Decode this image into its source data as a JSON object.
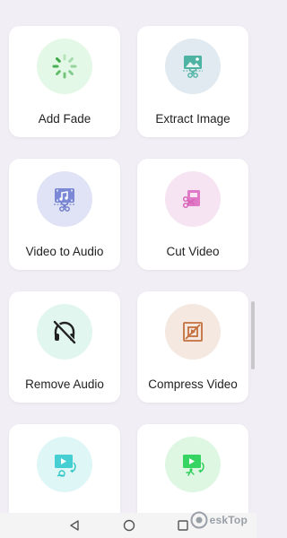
{
  "tools": [
    {
      "label": "Add Fade",
      "icon": "fade-spinner-icon",
      "bg": "#e3f8e6",
      "accent": "#3aa845"
    },
    {
      "label": "Extract Image",
      "icon": "extract-image-icon",
      "bg": "#e0eaf0",
      "accent": "#3a9d8c"
    },
    {
      "label": "Video to Audio",
      "icon": "video-to-audio-icon",
      "bg": "#e0e3f6",
      "accent": "#6a78c9"
    },
    {
      "label": "Cut Video",
      "icon": "cut-video-icon",
      "bg": "#f6e4f2",
      "accent": "#d864b8"
    },
    {
      "label": "Remove Audio",
      "icon": "remove-audio-icon",
      "bg": "#e2f6f0",
      "accent": "#222222"
    },
    {
      "label": "Compress Video",
      "icon": "compress-video-icon",
      "bg": "#f4e8e0",
      "accent": "#c4703e"
    },
    {
      "label": "",
      "icon": "slow-motion-icon",
      "bg": "#dff6f6",
      "accent": "#36c7c9"
    },
    {
      "label": "",
      "icon": "fast-motion-icon",
      "bg": "#def7e2",
      "accent": "#2ecf5a"
    }
  ],
  "navbar": {
    "back_icon": "back-triangle-icon",
    "home_icon": "home-circle-icon",
    "recent_icon": "recent-square-icon"
  },
  "watermark": {
    "text": "eskTop"
  }
}
